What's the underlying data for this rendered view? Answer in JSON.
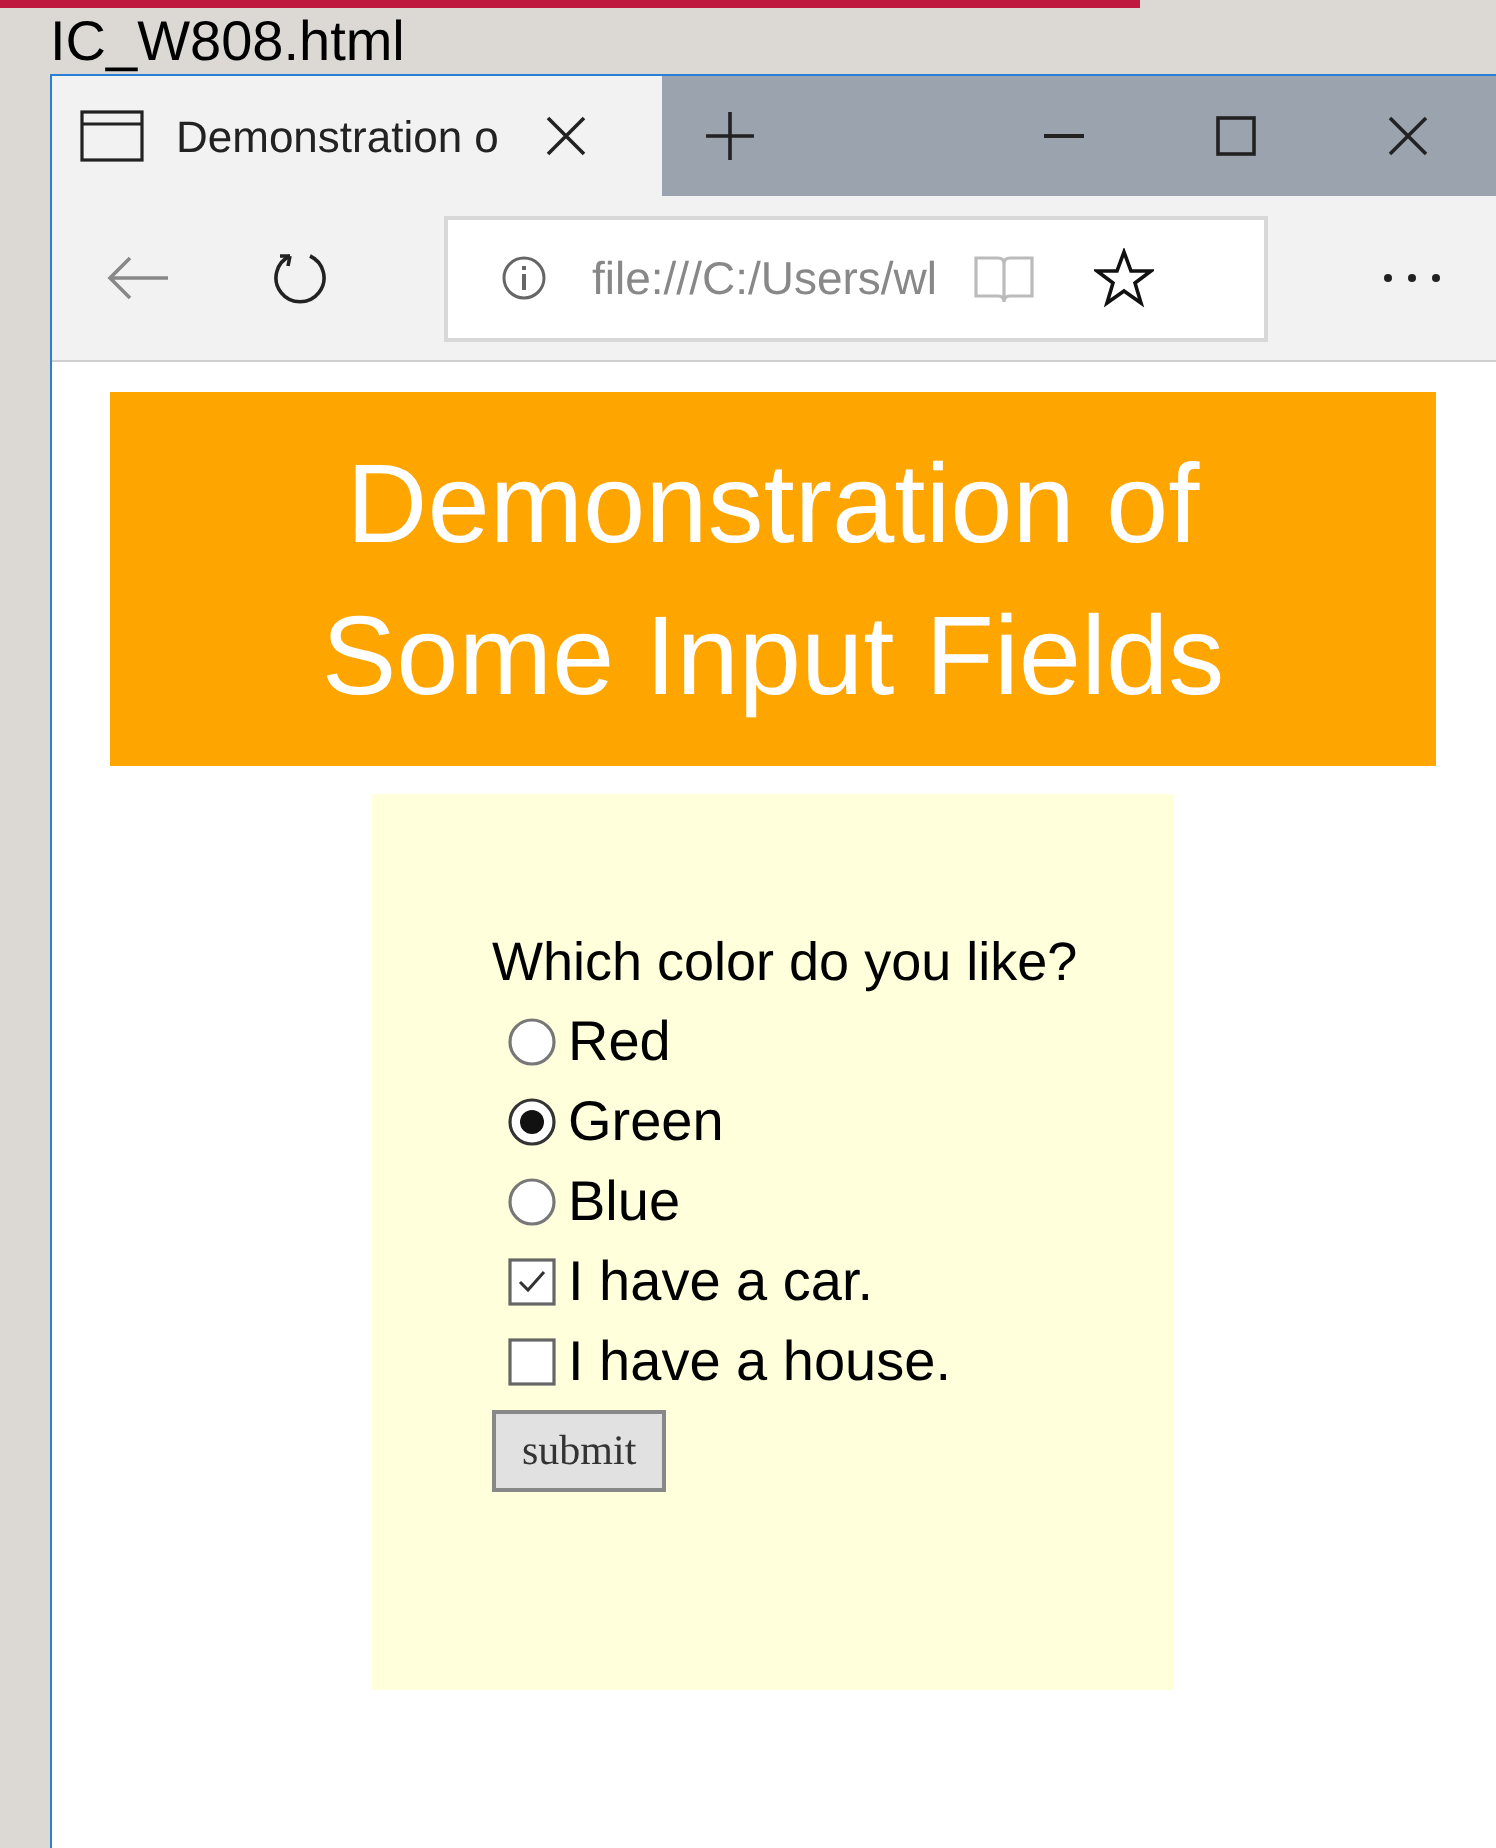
{
  "slide_title": "IC_W808.html",
  "browser": {
    "tab_title": "Demonstration o",
    "address": "file:///C:/Users/wl"
  },
  "page": {
    "heading": "Demonstration of Some Input Fields",
    "question": "Which color do you like?",
    "radios": [
      {
        "label": "Red",
        "selected": false
      },
      {
        "label": "Green",
        "selected": true
      },
      {
        "label": "Blue",
        "selected": false
      }
    ],
    "checkboxes": [
      {
        "label": "I have a car.",
        "checked": true
      },
      {
        "label": "I have a house.",
        "checked": false
      }
    ],
    "button": "submit"
  }
}
